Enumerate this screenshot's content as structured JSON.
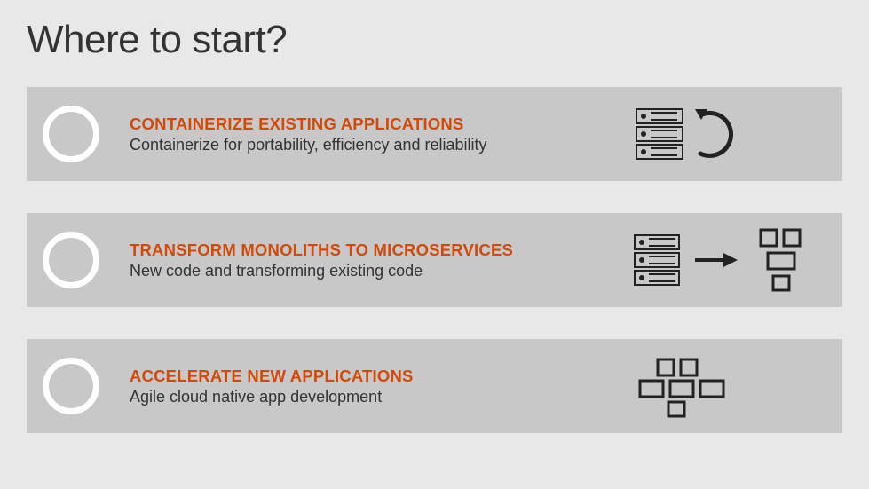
{
  "title": "Where to start?",
  "items": [
    {
      "heading": "CONTAINERIZE EXISTING APPLICATIONS",
      "desc": "Containerize for portability, efficiency and reliability"
    },
    {
      "heading": "TRANSFORM MONOLITHS TO MICROSERVICES",
      "desc": "New code and transforming existing code"
    },
    {
      "heading": "ACCELERATE NEW APPLICATIONS",
      "desc": "Agile cloud native app development"
    }
  ]
}
